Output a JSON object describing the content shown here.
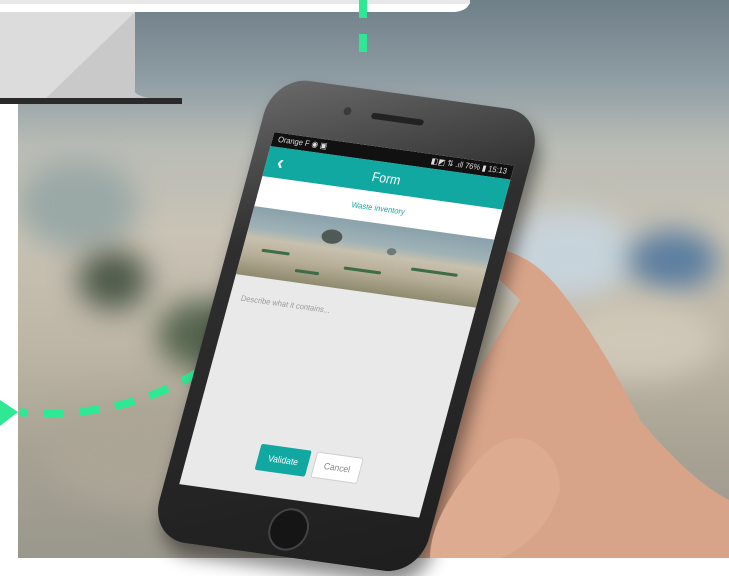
{
  "statusbar": {
    "left": "Orange F ◉ ▣",
    "right": "◧◩ ⇅ .ıll 76% ▮ 15:13"
  },
  "appbar": {
    "back_glyph": "‹",
    "title": "Form"
  },
  "subbar": {
    "label": "Waste inventory"
  },
  "description": {
    "placeholder": "Describe what it contains..."
  },
  "buttons": {
    "validate": "Validate",
    "cancel": "Cancel"
  },
  "colors": {
    "accent": "#11a8a1",
    "path_green": "#2ee893"
  }
}
